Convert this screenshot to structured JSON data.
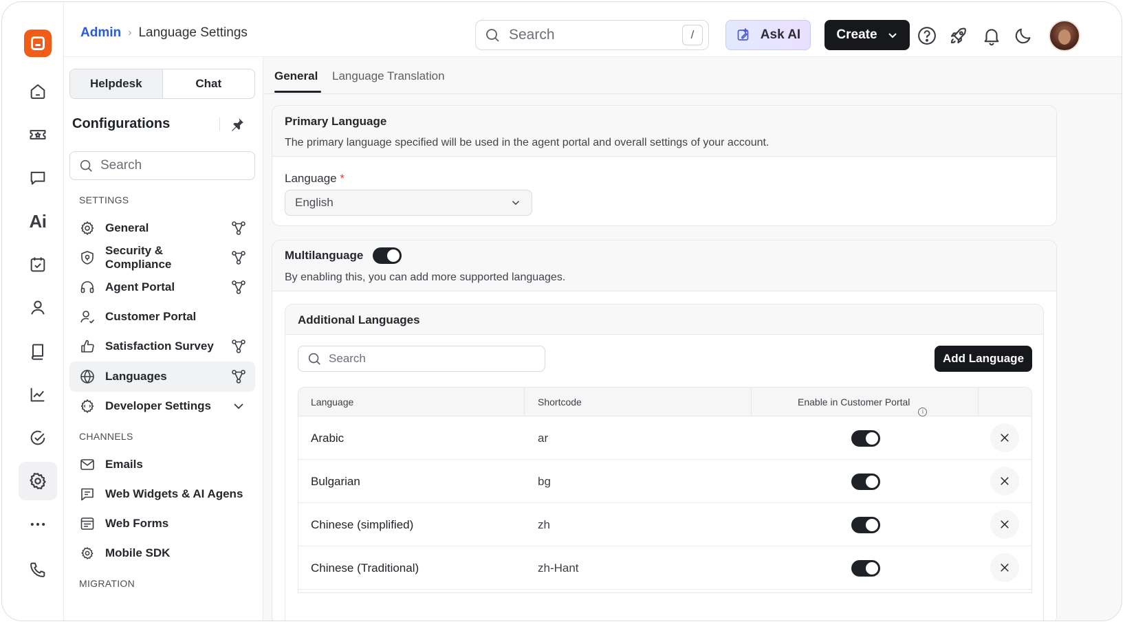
{
  "breadcrumb": {
    "root": "Admin",
    "current": "Language Settings"
  },
  "header": {
    "search_placeholder": "Search",
    "search_shortcut": "/",
    "ask_ai_label": "Ask AI",
    "create_label": "Create"
  },
  "sidebar": {
    "segments": [
      "Helpdesk",
      "Chat"
    ],
    "title": "Configurations",
    "search_placeholder": "Search",
    "section_settings": "SETTINGS",
    "section_channels": "CHANNELS",
    "section_migration": "MIGRATION",
    "items": [
      {
        "label": "General",
        "icon": "gear-icon"
      },
      {
        "label": "Security & Compliance",
        "icon": "shield-icon"
      },
      {
        "label": "Agent Portal",
        "icon": "headset-icon"
      },
      {
        "label": "Customer Portal",
        "icon": "user-check-icon"
      },
      {
        "label": "Satisfaction Survey",
        "icon": "thumbs-up-icon"
      },
      {
        "label": "Languages",
        "icon": "globe-icon"
      },
      {
        "label": "Developer Settings",
        "icon": "api-gear-icon"
      },
      {
        "label": "Emails",
        "icon": "mail-icon"
      },
      {
        "label": "Web Widgets & AI Agens",
        "icon": "chat-lines-icon"
      },
      {
        "label": "Web Forms",
        "icon": "form-icon"
      },
      {
        "label": "Mobile SDK",
        "icon": "sdk-gear-icon"
      }
    ]
  },
  "tabs": [
    "General",
    "Language Translation"
  ],
  "primary": {
    "title": "Primary Language",
    "description": "The primary language specified will be used in the agent portal and overall settings of your account.",
    "field_label": "Language",
    "required_mark": "*",
    "selected": "English"
  },
  "multilanguage": {
    "title": "Multilanguage",
    "enabled": true,
    "description": "By enabling this, you can add more supported languages."
  },
  "additional": {
    "title": "Additional Languages",
    "search_placeholder": "Search",
    "add_label": "Add Language",
    "columns": [
      "Language",
      "Shortcode",
      "Enable in Customer Portal"
    ],
    "rows": [
      {
        "language": "Arabic",
        "code": "ar",
        "enabled": true
      },
      {
        "language": "Bulgarian",
        "code": "bg",
        "enabled": true
      },
      {
        "language": "Chinese (simplified)",
        "code": "zh",
        "enabled": true
      },
      {
        "language": "Chinese (Traditional)",
        "code": "zh-Hant",
        "enabled": true
      }
    ]
  },
  "colors": {
    "accent": "#2a5bd7",
    "brand": "#f25c19",
    "dark": "#16181b"
  }
}
